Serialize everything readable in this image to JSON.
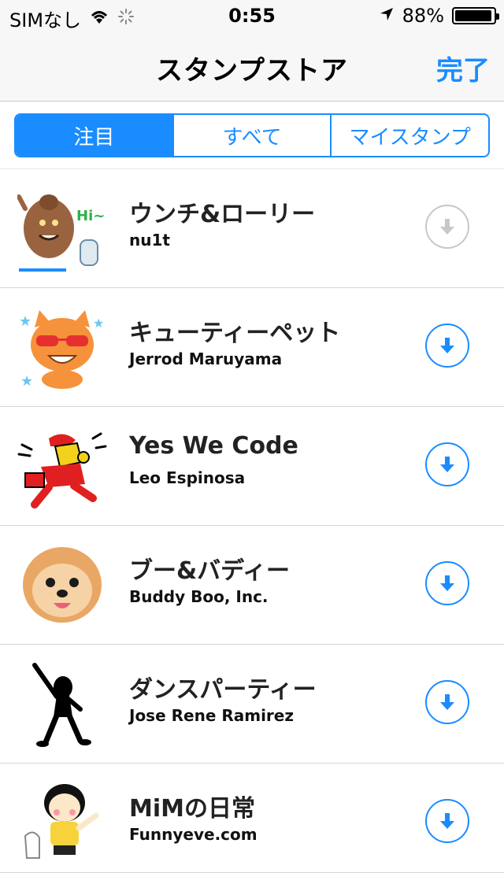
{
  "status_bar": {
    "carrier": "SIMなし",
    "time": "0:55",
    "battery": "88%"
  },
  "nav": {
    "title": "スタンプストア",
    "done": "完了"
  },
  "segments": [
    "注目",
    "すべて",
    "マイスタンプ"
  ],
  "items": [
    {
      "title": "ウンチ&ローリー",
      "author": "nu1t",
      "download_enabled": false
    },
    {
      "title": "キューティーペット",
      "author": "Jerrod Maruyama",
      "download_enabled": true
    },
    {
      "title": "Yes We Code",
      "author": "Leo Espinosa",
      "download_enabled": true
    },
    {
      "title": "ブー&バディー",
      "author": "Buddy Boo, Inc.",
      "download_enabled": true
    },
    {
      "title": "ダンスパーティー",
      "author": "Jose Rene Ramirez",
      "download_enabled": true
    },
    {
      "title": "MiMの日常",
      "author": "Funnyeve.com",
      "download_enabled": true
    }
  ],
  "colors": {
    "accent": "#1a8cff",
    "disabled": "#c7c7cc"
  }
}
